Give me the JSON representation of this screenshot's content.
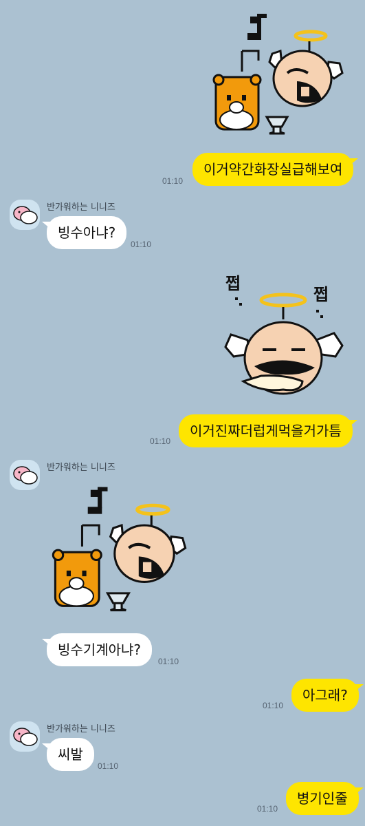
{
  "sender_name": "반가워하는 니니즈",
  "messages": [
    {
      "side": "me",
      "kind": "sticker",
      "sticker": "angel-bear-teacup-sticker"
    },
    {
      "side": "me",
      "kind": "text",
      "text": "이거약간화장실급해보여",
      "time": "01:10"
    },
    {
      "side": "other",
      "kind": "text",
      "text": "빙수아냐?",
      "time": "01:10"
    },
    {
      "side": "me",
      "kind": "sticker",
      "sticker": "angel-munching-sticker",
      "sticker_text": [
        "쩝",
        "쩝"
      ]
    },
    {
      "side": "me",
      "kind": "text",
      "text": "이거진짜더럽게먹을거가틈",
      "time": "01:10"
    },
    {
      "side": "other",
      "kind": "sticker",
      "sticker": "angel-bear-teacup-sticker"
    },
    {
      "side": "other",
      "kind": "text",
      "text": "빙수기계아냐?",
      "time": "01:10"
    },
    {
      "side": "me",
      "kind": "text",
      "text": "아그래?",
      "time": "01:10"
    },
    {
      "side": "other",
      "kind": "text",
      "text": "씨발",
      "time": "01:10"
    },
    {
      "side": "me",
      "kind": "text",
      "text": "병기인줄",
      "time": "01:10"
    }
  ],
  "colors": {
    "background": "#abc1d1",
    "my_bubble": "#fee500",
    "other_bubble": "#ffffff",
    "time_text": "#556270"
  }
}
